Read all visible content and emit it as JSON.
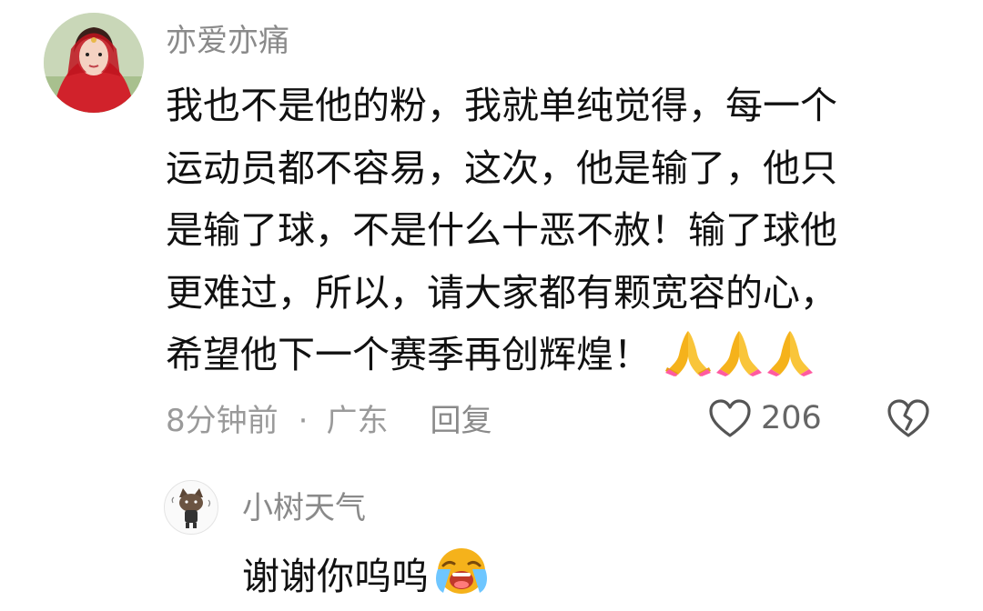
{
  "comment": {
    "username": "亦爱亦痛",
    "lines": [
      "我也不是他的粉，我就单纯觉得，每一个",
      "运动员都不容易，这次，他是输了，他只",
      "是输了球，不是什么十恶不赦！输了球他",
      "更难过，所以，请大家都有颗宽容的心，",
      "希望他下一个赛季再创辉煌！"
    ],
    "emojis": [
      "folded-hands",
      "folded-hands",
      "folded-hands"
    ],
    "time": "8分钟前",
    "separator": "·",
    "location": "广东",
    "reply_label": "回复",
    "like_count": "206"
  },
  "reply": {
    "username": "小树天气",
    "text": "谢谢你呜呜",
    "emoji": "crying-face"
  },
  "colors": {
    "username": "#8a8a8a",
    "text": "#111111",
    "meta": "#9a9a9a",
    "emoji": "#f5b21b"
  }
}
